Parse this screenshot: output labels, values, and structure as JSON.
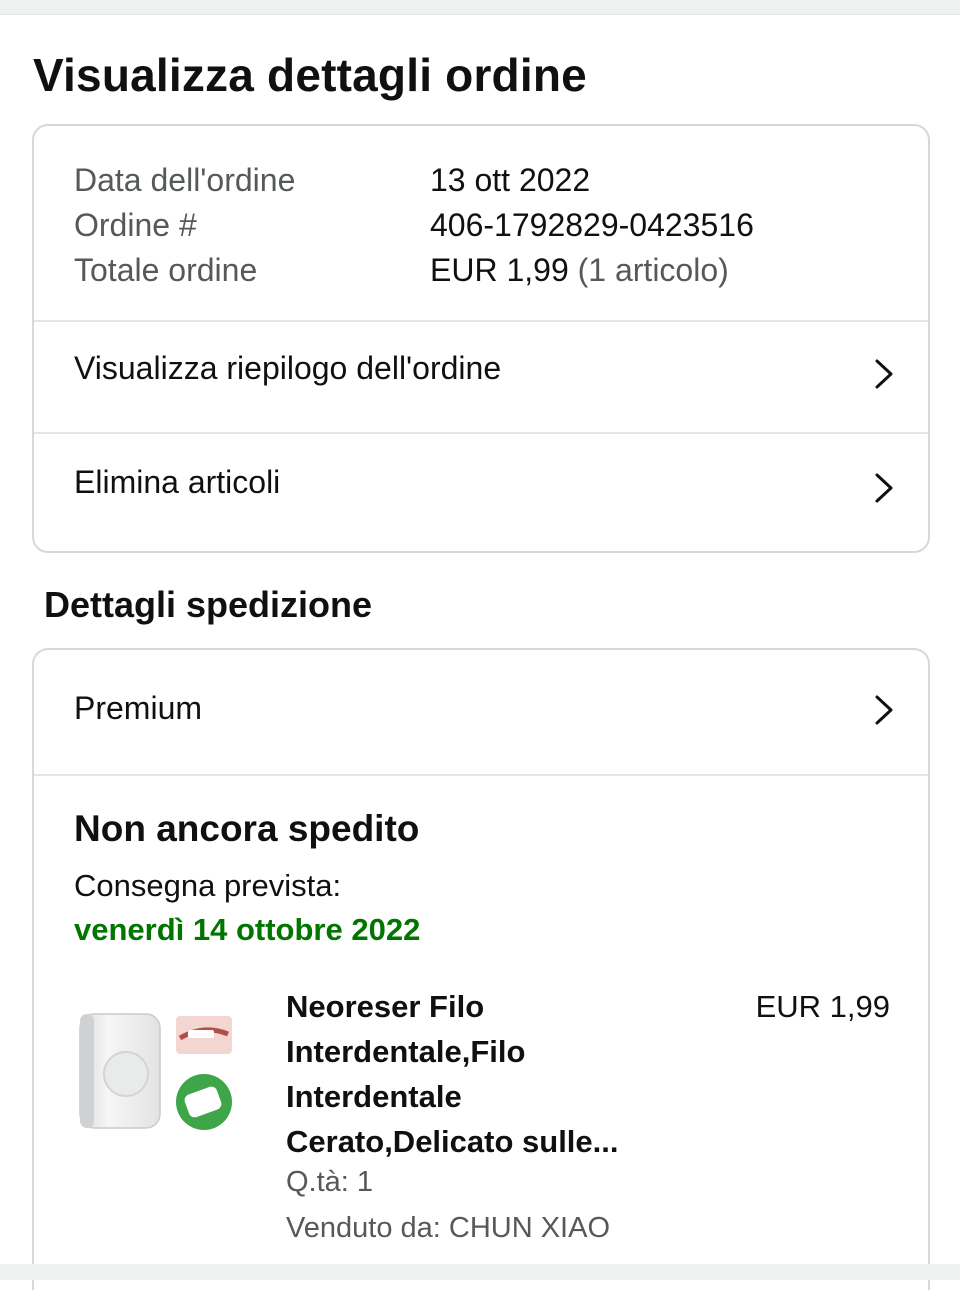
{
  "page": {
    "title": "Visualizza dettagli ordine"
  },
  "order": {
    "date_label": "Data dell'ordine",
    "date_value": "13 ott 2022",
    "number_label": "Ordine #",
    "number_value": "406-1792829-0423516",
    "total_label": "Totale ordine",
    "total_value": "EUR 1,99",
    "total_items": "(1 articolo)"
  },
  "links": {
    "summary": "Visualizza riepilogo dell'ordine",
    "delete_items": "Elimina articoli"
  },
  "shipping": {
    "section_title": "Dettagli spedizione",
    "method": "Premium",
    "status": "Non ancora spedito",
    "delivery_label": "Consegna prevista:",
    "delivery_date": "venerdì 14 ottobre 2022",
    "colors": {
      "delivery_green": "#007600"
    }
  },
  "product": {
    "title": "Neoreser Filo Interdentale,Filo Interdentale Cerato,Delicato sulle...",
    "price": "EUR 1,99",
    "qty": "Q.tà: 1",
    "seller": "Venduto da: CHUN XIAO",
    "image_icon": "dental-floss-product-image"
  }
}
